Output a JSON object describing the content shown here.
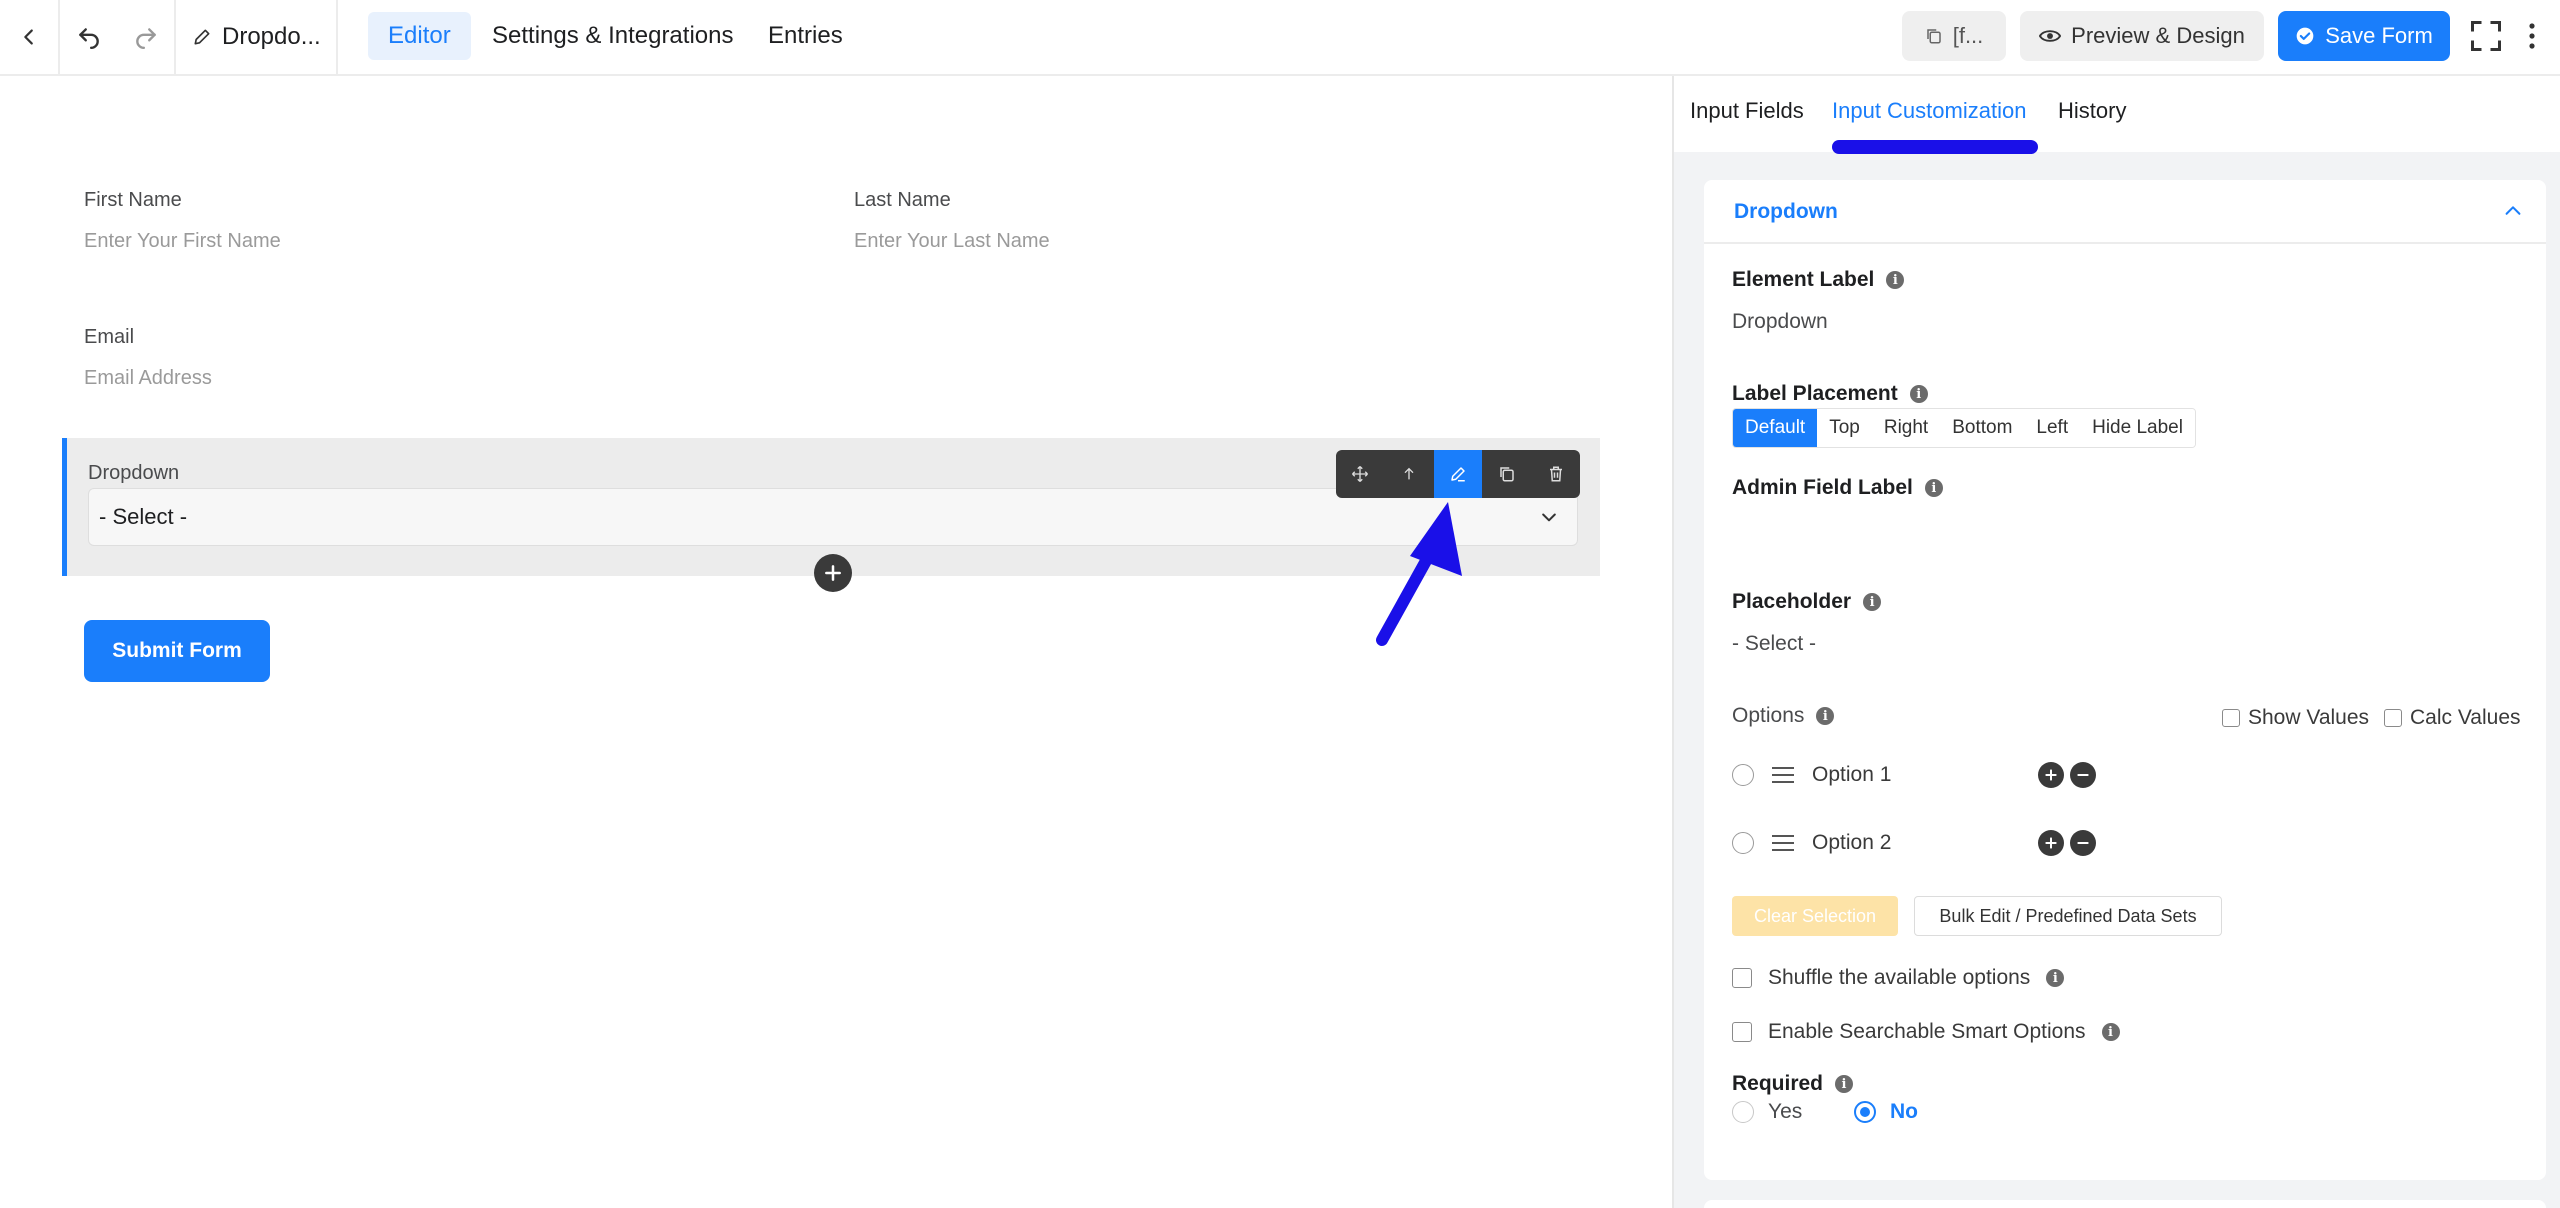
{
  "topbar": {
    "form_title": "Dropdo...",
    "nav": {
      "editor": "Editor",
      "settings": "Settings & Integrations",
      "entries": "Entries"
    },
    "shortcode_label": "[f...",
    "preview_label": "Preview & Design",
    "save_label": "Save Form"
  },
  "canvas": {
    "first_name": {
      "label": "First Name",
      "placeholder": "Enter Your First Name"
    },
    "last_name": {
      "label": "Last Name",
      "placeholder": "Enter Your Last Name"
    },
    "email": {
      "label": "Email",
      "placeholder": "Email Address"
    },
    "dropdown": {
      "label": "Dropdown",
      "selected": "- Select -"
    },
    "submit_label": "Submit Form"
  },
  "panel": {
    "tabs": {
      "input_fields": "Input Fields",
      "input_customization": "Input Customization",
      "history": "History"
    },
    "section_title": "Dropdown",
    "element_label": {
      "label": "Element Label",
      "value": "Dropdown"
    },
    "label_placement": {
      "label": "Label Placement",
      "options": [
        "Default",
        "Top",
        "Right",
        "Bottom",
        "Left",
        "Hide Label"
      ],
      "selected": "Default"
    },
    "admin_field_label": {
      "label": "Admin Field Label",
      "value": ""
    },
    "placeholder": {
      "label": "Placeholder",
      "value": "- Select -"
    },
    "options": {
      "label": "Options",
      "show_values": "Show Values",
      "calc_values": "Calc Values",
      "items": [
        "Option 1",
        "Option 2"
      ]
    },
    "clear_selection": "Clear Selection",
    "bulk_edit": "Bulk Edit / Predefined Data Sets",
    "shuffle": "Shuffle the available options",
    "searchable": "Enable Searchable Smart Options",
    "required": {
      "label": "Required",
      "yes": "Yes",
      "no": "No",
      "selected": "No"
    }
  },
  "colors": {
    "accent": "#1a7efb",
    "annotation_arrow": "#1a10e8",
    "toolbar_dark": "#3a3a3a"
  }
}
